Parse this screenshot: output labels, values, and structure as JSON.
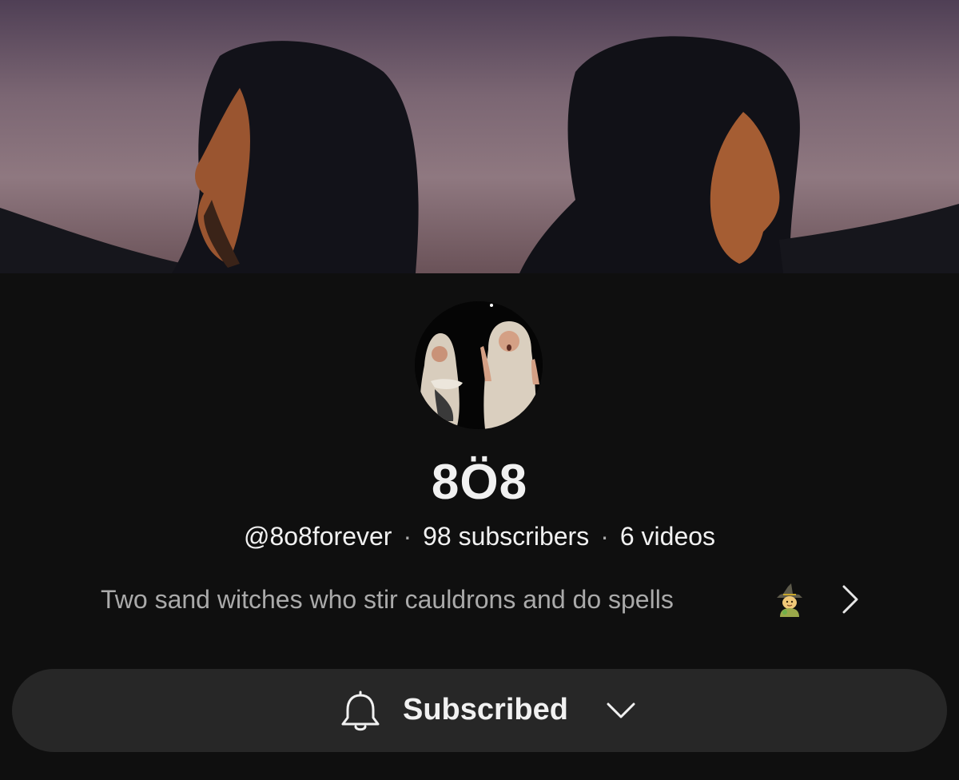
{
  "channel": {
    "name": "8Ö8",
    "handle": "@8o8forever",
    "subscribers": "98 subscribers",
    "videos": "6 videos",
    "separator": "·",
    "description": "Two sand witches who stir cauldrons and do spells"
  },
  "subscribe_button": {
    "label": "Subscribed"
  },
  "icons": {
    "bell": "bell-icon",
    "chevron_down": "chevron-down-icon",
    "chevron_right": "chevron-right-icon",
    "witch": "witch-emoji-icon"
  },
  "colors": {
    "background": "#0f0f0f",
    "button_bg": "#272727",
    "text_primary": "#f1f1f1",
    "text_secondary": "#aaaaaa"
  }
}
